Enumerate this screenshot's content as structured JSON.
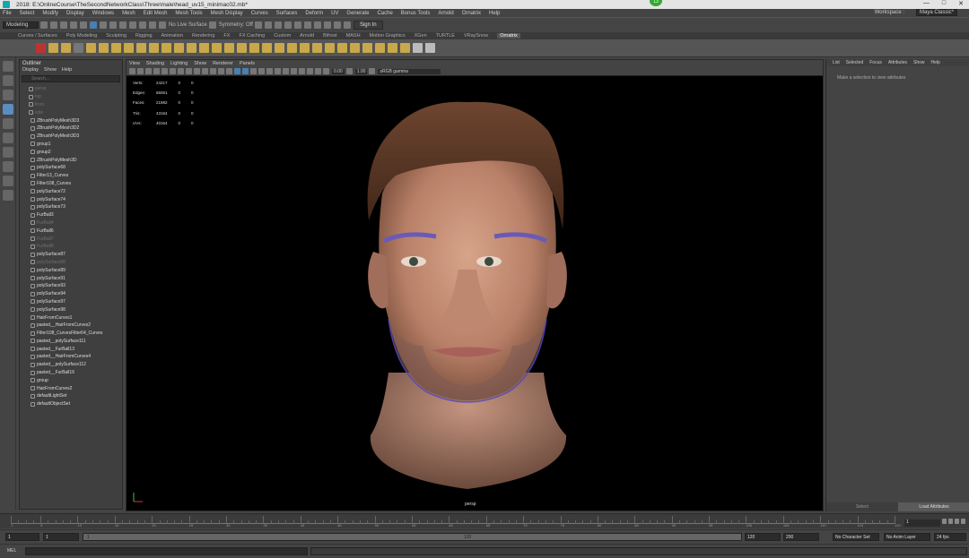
{
  "titlebar": {
    "app": "A",
    "title": "2018: E:\\OnlineCourse\\TheSecondNetworkClass\\Three\\male\\head_uv15_minimac02.mb*",
    "window_controls": [
      "—",
      "□",
      "✕"
    ]
  },
  "menubar": {
    "items": [
      "File",
      "Select",
      "Modify",
      "Display",
      "Windows",
      "Mesh",
      "Edit Mesh",
      "Mesh Tools",
      "Mesh Display",
      "Curves",
      "Surfaces",
      "Deform",
      "UV",
      "Generate",
      "Cache",
      "Bonus Tools",
      "Arnold",
      "Ornatrix",
      "Help"
    ],
    "workspace_label": "Workspace :",
    "workspace_value": "Maya Classic*"
  },
  "statusline": {
    "menuset": "Modeling",
    "live_surface": "No Live Surface",
    "symmetry": "Symmetry: Off",
    "sign_in": "Sign In"
  },
  "shelf_tabs": {
    "items": [
      "Curves / Surfaces",
      "Poly Modeling",
      "Sculpting",
      "Rigging",
      "Animation",
      "Rendering",
      "FX",
      "FX Caching",
      "Custom",
      "Arnold",
      "Bifrost",
      "MASH",
      "Motion Graphics",
      "XGen",
      "TURTLE",
      "VRaySnow",
      "Ornatrix"
    ],
    "active": "Ornatrix"
  },
  "outliner": {
    "title": "Outliner",
    "menu": [
      "Display",
      "Show",
      "Help"
    ],
    "search_placeholder": "Search...",
    "items": [
      {
        "label": "persp",
        "dim": true
      },
      {
        "label": "top",
        "dim": true
      },
      {
        "label": "front",
        "dim": true
      },
      {
        "label": "side",
        "dim": true
      },
      {
        "label": "ZBrushPolyMesh3D3",
        "dim": false
      },
      {
        "label": "ZBrushPolyMesh3D2",
        "dim": false
      },
      {
        "label": "ZBrushPolyMesh3D3",
        "dim": false
      },
      {
        "label": "group1",
        "dim": false
      },
      {
        "label": "group2",
        "dim": false
      },
      {
        "label": "ZBrushPolyMesh3D",
        "dim": false
      },
      {
        "label": "polySurface68",
        "dim": false
      },
      {
        "label": "Filter13_Curves",
        "dim": false
      },
      {
        "label": "Filter108_Curves",
        "dim": false
      },
      {
        "label": "polySurface72",
        "dim": false
      },
      {
        "label": "polySurface74",
        "dim": false
      },
      {
        "label": "polySurface73",
        "dim": false
      },
      {
        "label": "FurBall3",
        "dim": false
      },
      {
        "label": "FurBall4",
        "dim": true
      },
      {
        "label": "FurBall6",
        "dim": false
      },
      {
        "label": "FurBall7",
        "dim": true
      },
      {
        "label": "FurBall8",
        "dim": true
      },
      {
        "label": "polySurface87",
        "dim": false
      },
      {
        "label": "polySurface88",
        "dim": true
      },
      {
        "label": "polySurface89",
        "dim": false
      },
      {
        "label": "polySurface91",
        "dim": false
      },
      {
        "label": "polySurface93",
        "dim": false
      },
      {
        "label": "polySurface94",
        "dim": false
      },
      {
        "label": "polySurface97",
        "dim": false
      },
      {
        "label": "polySurface98",
        "dim": false
      },
      {
        "label": "HairFromCurves1",
        "dim": false
      },
      {
        "label": "pasted__HairFromCurves2",
        "dim": false
      },
      {
        "label": "Filter108_CurvesFilter64_Curves",
        "dim": false
      },
      {
        "label": "pasted__polySurface111",
        "dim": false
      },
      {
        "label": "pasted__FurBall13",
        "dim": false
      },
      {
        "label": "pasted__HairFromCurves4",
        "dim": false
      },
      {
        "label": "pasted__polySurface112",
        "dim": false
      },
      {
        "label": "pasted__FurBall16",
        "dim": false
      },
      {
        "label": "group",
        "dim": false
      },
      {
        "label": "HairFromCurves2",
        "dim": false
      },
      {
        "label": "defaultLightSet",
        "dim": false
      },
      {
        "label": "defaultObjectSet",
        "dim": false
      }
    ]
  },
  "viewport": {
    "menu": [
      "View",
      "Shading",
      "Lighting",
      "Show",
      "Renderer",
      "Panels"
    ],
    "gamma": "0.00",
    "exposure": "1.00",
    "colorspace": "sRGB gamma",
    "hud": [
      {
        "label": "Verts:",
        "a": "24217",
        "b": "0",
        "c": "0"
      },
      {
        "label": "Edges:",
        "a": "65061",
        "b": "0",
        "c": "0"
      },
      {
        "label": "Faces:",
        "a": "21982",
        "b": "0",
        "c": "0"
      },
      {
        "label": "Tris:",
        "a": "43164",
        "b": "0",
        "c": "0"
      },
      {
        "label": "UVs:",
        "a": "40164",
        "b": "0",
        "c": "0"
      }
    ],
    "camera_label": "persp"
  },
  "attribute_editor": {
    "menu": [
      "List",
      "Selected",
      "Focus",
      "Attributes",
      "Show",
      "Help"
    ],
    "message": "Make a selection to view attributes",
    "buttons": [
      "Select",
      "Load Attributes"
    ]
  },
  "timeslider": {
    "tick_labels": [
      "1",
      "5",
      "10",
      "15",
      "20",
      "25",
      "30",
      "35",
      "40",
      "45",
      "50",
      "55",
      "60",
      "65",
      "70",
      "75",
      "80",
      "85",
      "90",
      "95",
      "100",
      "105",
      "110",
      "115",
      "120"
    ],
    "current_frame": "1"
  },
  "range": {
    "start": "1",
    "inner_start": "1",
    "slider_start": "1",
    "slider_mid": "120",
    "slider_end": "120",
    "end": "200",
    "character_set": "No Character Set",
    "anim_layer": "No Anim Layer",
    "fps": "24 fps"
  },
  "cmdline": {
    "label": "MEL"
  },
  "colors": {
    "panel": "#444444",
    "viewport_bg": "#000000",
    "accent": "#5a8dc0",
    "maya_logo": "#1ab3c7"
  }
}
